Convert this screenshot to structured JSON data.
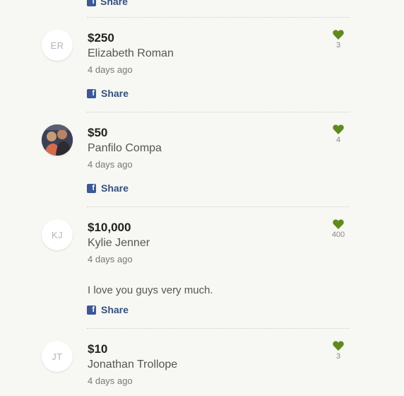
{
  "share_label": "Share",
  "donations": [
    {
      "initials": "ER",
      "amount": "$250",
      "name": "Elizabeth Roman",
      "time": "4 days ago",
      "comment": "",
      "likes": "3"
    },
    {
      "initials": "",
      "amount": "$50",
      "name": "Panfilo Compa",
      "time": "4 days ago",
      "comment": "",
      "likes": "4"
    },
    {
      "initials": "KJ",
      "amount": "$10,000",
      "name": "Kylie Jenner",
      "time": "4 days ago",
      "comment": "I love you guys very much.",
      "likes": "400"
    },
    {
      "initials": "JT",
      "amount": "$10",
      "name": "Jonathan Trollope",
      "time": "4 days ago",
      "comment": "",
      "likes": "3"
    }
  ],
  "colors": {
    "heart": "#5f8a1e",
    "share": "#35507d",
    "facebook": "#3b5998",
    "background": "#f7f7f3"
  },
  "icons": {
    "share": "facebook-icon",
    "like": "heart-icon"
  }
}
